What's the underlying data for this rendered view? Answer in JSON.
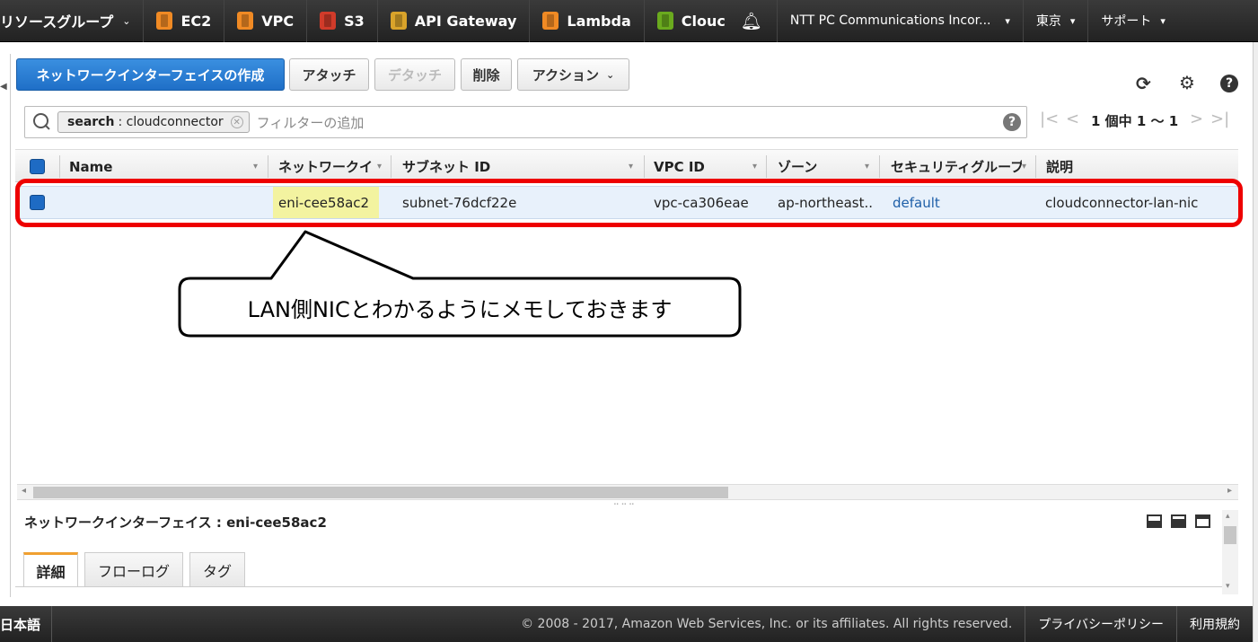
{
  "topnav": {
    "resource_groups": "リソースグループ",
    "services": [
      {
        "label": "EC2",
        "icon": "ec2-icon"
      },
      {
        "label": "VPC",
        "icon": "vpc-icon"
      },
      {
        "label": "S3",
        "icon": "s3-icon"
      },
      {
        "label": "API Gateway",
        "icon": "api-gateway-icon"
      },
      {
        "label": "Lambda",
        "icon": "lambda-icon"
      },
      {
        "label": "Clouc",
        "icon": "cloud-icon"
      }
    ],
    "account": "NTT PC Communications Incor...",
    "region": "東京",
    "support": "サポート"
  },
  "toolbar": {
    "create_label": "ネットワークインターフェイスの作成",
    "attach_label": "アタッチ",
    "detach_label": "デタッチ",
    "delete_label": "削除",
    "actions_label": "アクション"
  },
  "search": {
    "token_key": "search",
    "token_value": ": cloudconnector",
    "placeholder": "フィルターの追加"
  },
  "pager": {
    "text": "1 個中 1 ～ 1"
  },
  "table": {
    "columns": [
      "Name",
      "ネットワークイ",
      "サブネット ID",
      "VPC ID",
      "ゾーン",
      "セキュリティグループ",
      "説明"
    ],
    "rows": [
      {
        "name": "",
        "eni": "eni-cee58ac2",
        "subnet": "subnet-76dcf22e",
        "vpc": "vpc-ca306eae",
        "zone": "ap-northeast...",
        "security_group": "default",
        "description": "cloudconnector-lan-nic"
      }
    ]
  },
  "callout": {
    "text": "LAN側NICとわかるようにメモしておきます"
  },
  "detail": {
    "title": "ネットワークインターフェイス : eni-cee58ac2",
    "tabs": [
      "詳細",
      "フローログ",
      "タグ"
    ]
  },
  "footer": {
    "language": "日本語",
    "copyright": "© 2008 - 2017, Amazon Web Services, Inc. or its affiliates. All rights reserved.",
    "privacy": "プライバシーポリシー",
    "terms": "利用規約"
  },
  "colors": {
    "primary_button": "#1f6fc7",
    "highlight_border": "#ee0000",
    "eni_highlight": "#f3f3a0",
    "link": "#1e5fa8"
  }
}
